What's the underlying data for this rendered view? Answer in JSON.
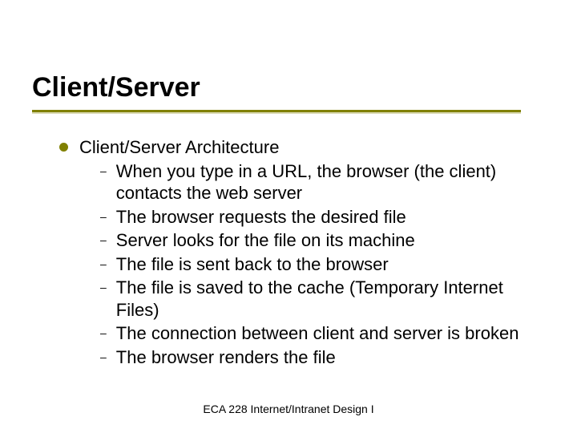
{
  "slide": {
    "title": "Client/Server",
    "level1": "Client/Server Architecture",
    "level2": [
      "When you type in a URL, the browser (the client) contacts the web server",
      "The browser requests the desired file",
      "Server looks for the file on its machine",
      "The file is sent back to the browser",
      "The file is saved to the cache (Temporary Internet Files)",
      "The connection between client and server is broken",
      "The browser renders the file"
    ],
    "footer": "ECA 228  Internet/Intranet Design I"
  }
}
